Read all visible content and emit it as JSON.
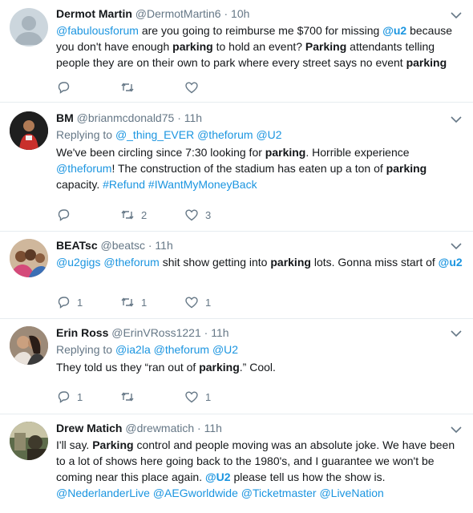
{
  "tweets": [
    {
      "name": "Dermot Martin",
      "handle": "@DermotMartin6",
      "dot": "·",
      "time": "10h",
      "replying": null,
      "body": [
        {
          "t": "@fabulousforum",
          "s": "m"
        },
        {
          "t": " are you going to reimburse me $700 for missing ",
          "s": ""
        },
        {
          "t": "@u2",
          "s": "mb"
        },
        {
          "t": " because you don't have enough ",
          "s": ""
        },
        {
          "t": "parking",
          "s": "b"
        },
        {
          "t": " to hold an event? ",
          "s": ""
        },
        {
          "t": "Parking",
          "s": "b"
        },
        {
          "t": " attendants telling people they are on their own to park where every street says no event ",
          "s": ""
        },
        {
          "t": "parking",
          "s": "b"
        }
      ],
      "reply_count": "",
      "retweet_count": "",
      "like_count": ""
    },
    {
      "name": "BM",
      "handle": "@brianmcdonald75",
      "dot": "·",
      "time": "11h",
      "replying": {
        "prefix": "Replying to ",
        "mentions": "@_thing_EVER @theforum @U2"
      },
      "body": [
        {
          "t": "We've been circling since 7:30 looking for ",
          "s": ""
        },
        {
          "t": "parking",
          "s": "b"
        },
        {
          "t": ". Horrible experience ",
          "s": ""
        },
        {
          "t": "@theforum",
          "s": "m"
        },
        {
          "t": "!  The construction of the stadium has eaten up  a ton of ",
          "s": ""
        },
        {
          "t": "parking",
          "s": "b"
        },
        {
          "t": " capacity. ",
          "s": ""
        },
        {
          "t": "#Refund #IWantMyMoneyBack",
          "s": "m"
        }
      ],
      "reply_count": "",
      "retweet_count": "2",
      "like_count": "3"
    },
    {
      "name": "BEATsc",
      "handle": "@beatsc",
      "dot": "·",
      "time": "11h",
      "replying": null,
      "body": [
        {
          "t": "@u2gigs @theforum",
          "s": "m"
        },
        {
          "t": " shit show getting into ",
          "s": ""
        },
        {
          "t": "parking",
          "s": "b"
        },
        {
          "t": " lots. Gonna miss start of ",
          "s": ""
        },
        {
          "t": "@u2",
          "s": "mb"
        }
      ],
      "reply_count": "1",
      "retweet_count": "1",
      "like_count": "1"
    },
    {
      "name": "Erin Ross",
      "handle": "@ErinVRoss1221",
      "dot": "·",
      "time": "11h",
      "replying": {
        "prefix": "Replying to ",
        "mentions": "@ia2la @theforum @U2"
      },
      "body": [
        {
          "t": "They told us they “ran out of ",
          "s": ""
        },
        {
          "t": "parking",
          "s": "b"
        },
        {
          "t": ".” Cool.",
          "s": ""
        }
      ],
      "reply_count": "1",
      "retweet_count": "",
      "like_count": "1"
    },
    {
      "name": "Drew Matich",
      "handle": "@drewmatich",
      "dot": "·",
      "time": "11h",
      "replying": null,
      "body": [
        {
          "t": "I'll say. ",
          "s": ""
        },
        {
          "t": "Parking",
          "s": "b"
        },
        {
          "t": " control and people moving was an absolute joke. We have been to a lot of shows here going back to the 1980's, and I guarantee we won't be coming near this place again. ",
          "s": ""
        },
        {
          "t": "@U2",
          "s": "mb"
        },
        {
          "t": " please tell us how the show is. ",
          "s": ""
        },
        {
          "t": "@NederlanderLive @AEGworldwide @Ticketmaster @LiveNation",
          "s": "m"
        }
      ],
      "reply_count": "",
      "retweet_count": "",
      "like_count": ""
    }
  ],
  "colors": {
    "link": "#1b95e0",
    "muted": "#657786",
    "divider": "#e6ecf0"
  },
  "icons": [
    "reply-icon",
    "retweet-icon",
    "like-icon",
    "chevron-down-icon"
  ]
}
